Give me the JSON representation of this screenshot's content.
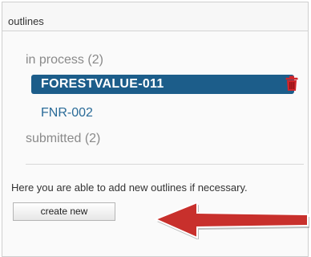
{
  "panel": {
    "title": "outlines"
  },
  "groups": {
    "in_process": {
      "label": "in process",
      "count": "(2)"
    },
    "submitted": {
      "label": "submitted",
      "count": "(2)"
    }
  },
  "outlines": [
    {
      "label": "FORESTVALUE-011",
      "selected": true
    },
    {
      "label": "FNR-002",
      "selected": false
    }
  ],
  "help_text": "Here you are able to add new outlines if necessary.",
  "create_button_label": "create new",
  "colors": {
    "selected_bg": "#1c5d8a",
    "link": "#2a6b98",
    "trash": "#d0252a",
    "arrow": "#c8302c"
  },
  "icons": {
    "delete": "trash-icon",
    "annotation": "arrow-left-icon"
  }
}
